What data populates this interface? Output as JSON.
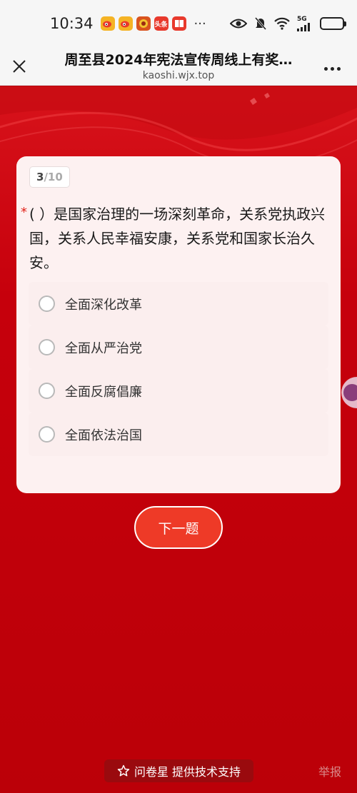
{
  "status_bar": {
    "time": "10:34",
    "more": "···",
    "network": "5G",
    "apps": [
      {
        "icon": "weibo-icon",
        "color": "#f0a020",
        "text": ""
      },
      {
        "icon": "weibo-icon",
        "color": "#f0a020",
        "text": ""
      },
      {
        "icon": "game-icon",
        "color": "#c23a12",
        "text": ""
      },
      {
        "icon": "toutiao-icon",
        "color": "#e8392c",
        "text": "头条"
      },
      {
        "icon": "book-icon",
        "color": "#e8392c",
        "text": ""
      }
    ]
  },
  "header": {
    "title": "周至县2024年宪法宣传周线上有奖…",
    "url": "kaoshi.wjx.top"
  },
  "question": {
    "current": "3",
    "separator": "/",
    "total": "10",
    "required_mark": "*",
    "text": "( ）是国家治理的一场深刻革命，关系党执政兴国，关系人民幸福安康，关系党和国家长治久安。",
    "options": [
      {
        "label": "全面深化改革"
      },
      {
        "label": "全面从严治党"
      },
      {
        "label": "全面反腐倡廉"
      },
      {
        "label": "全面依法治国"
      }
    ]
  },
  "actions": {
    "next_label": "下一题"
  },
  "footer": {
    "brand_text": "问卷星 提供技术支持",
    "report_label": "举报"
  },
  "colors": {
    "brand_red": "#c6000c",
    "button_red": "#ee3a27",
    "required_red": "#e2231a"
  }
}
